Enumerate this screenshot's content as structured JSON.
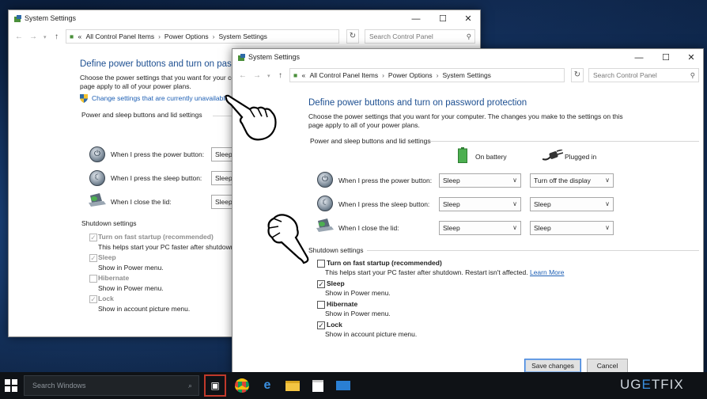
{
  "back_window": {
    "title": "System Settings",
    "breadcrumb": [
      "All Control Panel Items",
      "Power Options",
      "System Settings"
    ],
    "breadcrumb_prefix": "«",
    "search_placeholder": "Search Control Panel",
    "heading": "Define power buttons and turn on passw",
    "desc_line1": "Choose the power settings that you want for your co",
    "desc_line2": "page apply to all of your power plans.",
    "change_link": "Change settings that are currently unavailable",
    "section_power": "Power and sleep buttons and lid settings",
    "rows": [
      {
        "label": "When I press the power button:",
        "value": "Sleep"
      },
      {
        "label": "When I press the sleep button:",
        "value": "Sleep"
      },
      {
        "label": "When I close the lid:",
        "value": "Sleep"
      }
    ],
    "section_shutdown": "Shutdown settings",
    "shutdown": [
      {
        "label": "Turn on fast startup (recommended)",
        "desc": "This helps start your PC faster after shutdown.",
        "checked": true
      },
      {
        "label": "Sleep",
        "desc": "Show in Power menu.",
        "checked": true
      },
      {
        "label": "Hibernate",
        "desc": "Show in Power menu.",
        "checked": false
      },
      {
        "label": "Lock",
        "desc": "Show in account picture menu.",
        "checked": true
      }
    ]
  },
  "front_window": {
    "title": "System Settings",
    "breadcrumb": [
      "All Control Panel Items",
      "Power Options",
      "System Settings"
    ],
    "breadcrumb_prefix": "«",
    "search_placeholder": "Search Control Panel",
    "heading": "Define power buttons and turn on password protection",
    "desc_line1": "Choose the power settings that you want for your computer. The changes you make to the settings on this",
    "desc_line2": "page apply to all of your power plans.",
    "section_power": "Power and sleep buttons and lid settings",
    "col_battery": "On battery",
    "col_plugged": "Plugged in",
    "rows": [
      {
        "label": "When I press the power button:",
        "battery": "Sleep",
        "plugged": "Turn off the display"
      },
      {
        "label": "When I press the sleep button:",
        "battery": "Sleep",
        "plugged": "Sleep"
      },
      {
        "label": "When I close the lid:",
        "battery": "Sleep",
        "plugged": "Sleep"
      }
    ],
    "section_shutdown": "Shutdown settings",
    "shutdown": [
      {
        "label": "Turn on fast startup (recommended)",
        "desc": "This helps start your PC faster after shutdown. Restart isn't affected.",
        "link": "Learn More",
        "checked": false
      },
      {
        "label": "Sleep",
        "desc": "Show in Power menu.",
        "checked": true
      },
      {
        "label": "Hibernate",
        "desc": "Show in Power menu.",
        "checked": false
      },
      {
        "label": "Lock",
        "desc": "Show in account picture menu.",
        "checked": true
      }
    ],
    "save_label": "Save changes",
    "cancel_label": "Cancel"
  },
  "taskbar": {
    "search_placeholder": "Search Windows",
    "apps": [
      "task-view",
      "chrome",
      "edge",
      "file-explorer",
      "store",
      "mail"
    ]
  },
  "watermark": {
    "part1": "UG",
    "part2": "E",
    "part3": "T",
    "part4": "FIX"
  },
  "check_glyph": "✓",
  "colors": {
    "heading": "#1d4f91",
    "link": "#1d5fb4",
    "accent": "#3c7fd9"
  }
}
